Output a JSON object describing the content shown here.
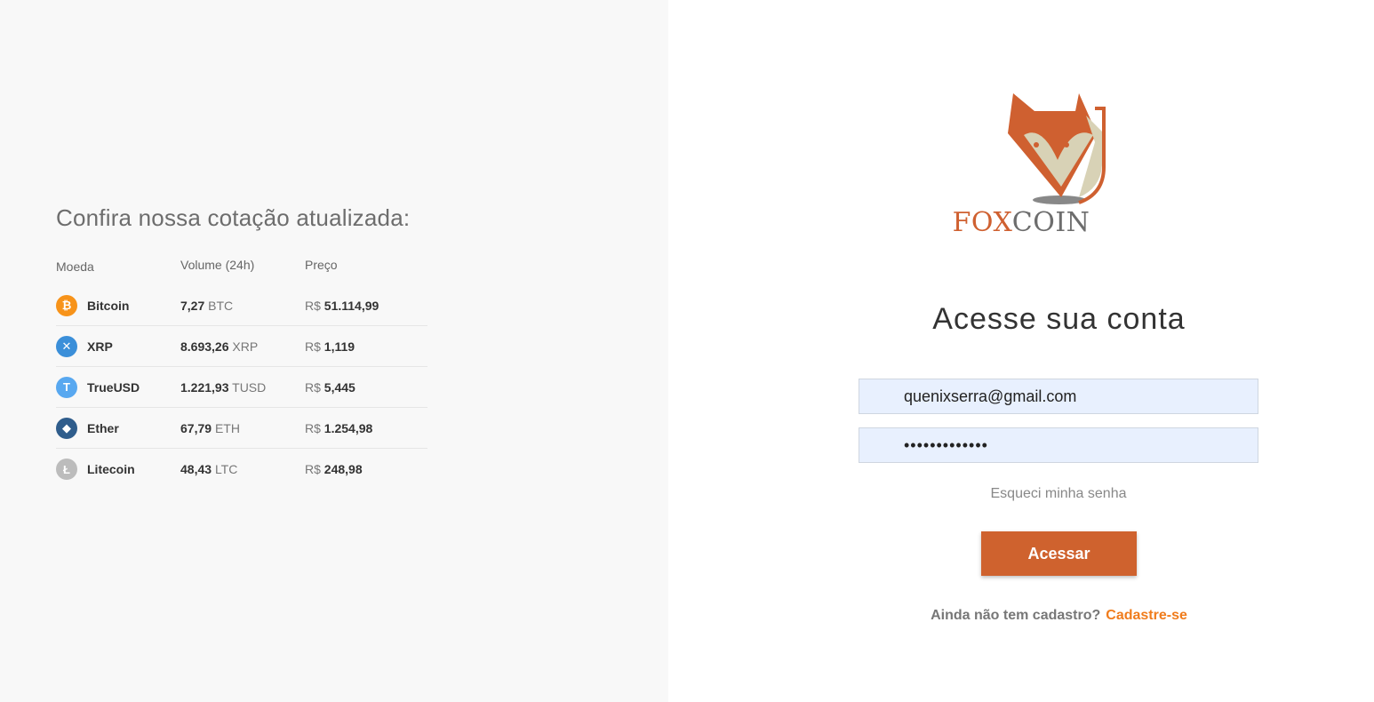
{
  "quotes": {
    "title": "Confira nossa cotação atualizada:",
    "headers": {
      "coin": "Moeda",
      "volume": "Volume (24h)",
      "price": "Preço"
    },
    "rows": [
      {
        "icon": "bitcoin-icon",
        "color": "#f7931a",
        "glyph": "₿",
        "name": "Bitcoin",
        "volume": "7,27",
        "unit": "BTC",
        "currency": "R$",
        "price": "51.114,99"
      },
      {
        "icon": "xrp-icon",
        "color": "#3b8fd9",
        "glyph": "✕",
        "name": "XRP",
        "volume": "8.693,26",
        "unit": "XRP",
        "currency": "R$",
        "price": "1,119"
      },
      {
        "icon": "trueusd-icon",
        "color": "#58a8f0",
        "glyph": "T",
        "name": "TrueUSD",
        "volume": "1.221,93",
        "unit": "TUSD",
        "currency": "R$",
        "price": "5,445"
      },
      {
        "icon": "ether-icon",
        "color": "#2f5d8c",
        "glyph": "◆",
        "name": "Ether",
        "volume": "67,79",
        "unit": "ETH",
        "currency": "R$",
        "price": "1.254,98"
      },
      {
        "icon": "litecoin-icon",
        "color": "#bcbcbc",
        "glyph": "Ł",
        "name": "Litecoin",
        "volume": "48,43",
        "unit": "LTC",
        "currency": "R$",
        "price": "248,98"
      }
    ]
  },
  "brand": {
    "fox": "FOX",
    "coin": "COIN",
    "accent": "#cf6030"
  },
  "login": {
    "heading": "Acesse sua conta",
    "email_value": "quenixserra@gmail.com",
    "password_value": "•••••••••••••",
    "forgot_label": "Esqueci minha senha",
    "submit_label": "Acessar",
    "signup_prompt": "Ainda não tem cadastro?",
    "signup_link": "Cadastre-se"
  }
}
